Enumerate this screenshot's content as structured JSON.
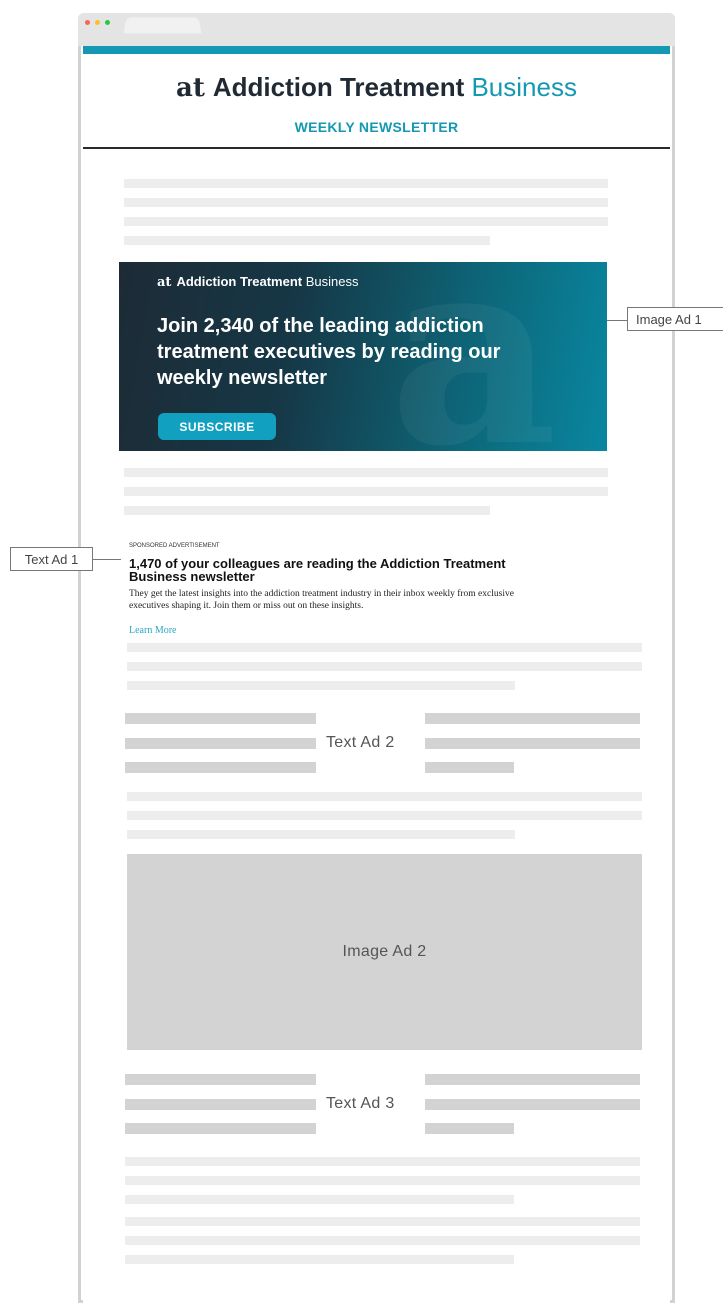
{
  "colors": {
    "teal": "#1599b3",
    "navy": "#1f2a34",
    "subscribe_bg": "#12a0c0",
    "link": "#2aa8c6",
    "placeholder_dark": "#d3d3d3",
    "placeholder_light": "#ededed"
  },
  "window": {
    "dots": [
      {
        "name": "close-dot",
        "color": "#ff6159"
      },
      {
        "name": "minimize-dot",
        "color": "#ffbd2e"
      },
      {
        "name": "maximize-dot",
        "color": "#28c941"
      }
    ]
  },
  "header": {
    "logo_mark": "at",
    "brand_bold": "Addiction Treatment",
    "brand_light": "Business",
    "newsletter_label": "WEEKLY NEWSLETTER"
  },
  "image_ad_1": {
    "brand_mark": "at",
    "brand_bold": "Addiction Treatment",
    "brand_light": "Business",
    "headline": "Join 2,340 of the leading addiction treatment executives by reading our weekly newsletter",
    "cta": "SUBSCRIBE"
  },
  "text_ad_1": {
    "sponsored_label": "SPONSORED ADVERTISEMENT",
    "headline": "1,470 of your colleagues are reading the Addiction Treatment Business newsletter",
    "body": "They get the latest insights into the addiction treatment industry in their inbox weekly from exclusive executives shaping it. Join them or miss out on these insights.",
    "link": "Learn More"
  },
  "slots": {
    "text_ad_2": "Text Ad 2",
    "image_ad_2": "Image Ad 2",
    "text_ad_3": "Text Ad 3"
  },
  "callouts": {
    "image_ad_1": "Image Ad 1",
    "text_ad_1": "Text Ad 1"
  }
}
